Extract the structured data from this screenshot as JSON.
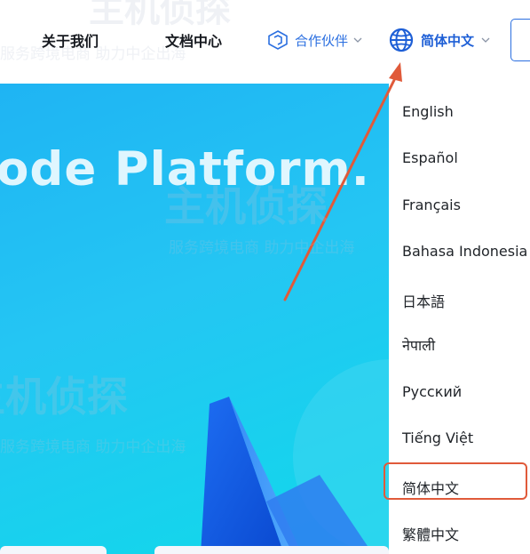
{
  "nav": {
    "about_label": "关于我们",
    "docs_label": "文档中心",
    "partners_label": "合作伙伴",
    "language_label": "简体中文"
  },
  "hero": {
    "title": "ode Platform."
  },
  "language_menu": {
    "items": [
      "English",
      "Español",
      "Français",
      "Bahasa Indonesia",
      "日本語",
      "नेपाली",
      "Русский",
      "Tiếng Việt",
      "简体中文",
      "繁體中文"
    ],
    "selected": "简体中文"
  },
  "watermark": {
    "brand": "主机侦探",
    "slogan": "服务跨境电商 助力中企出海"
  },
  "colors": {
    "accent_blue": "#2b6fe0",
    "annotation_red": "#e05a3a",
    "hero_cyan": "#1fc0f2"
  },
  "icons": {
    "partners": "hexagon-icon",
    "language": "globe-icon",
    "dropdown": "chevron-down-icon"
  }
}
